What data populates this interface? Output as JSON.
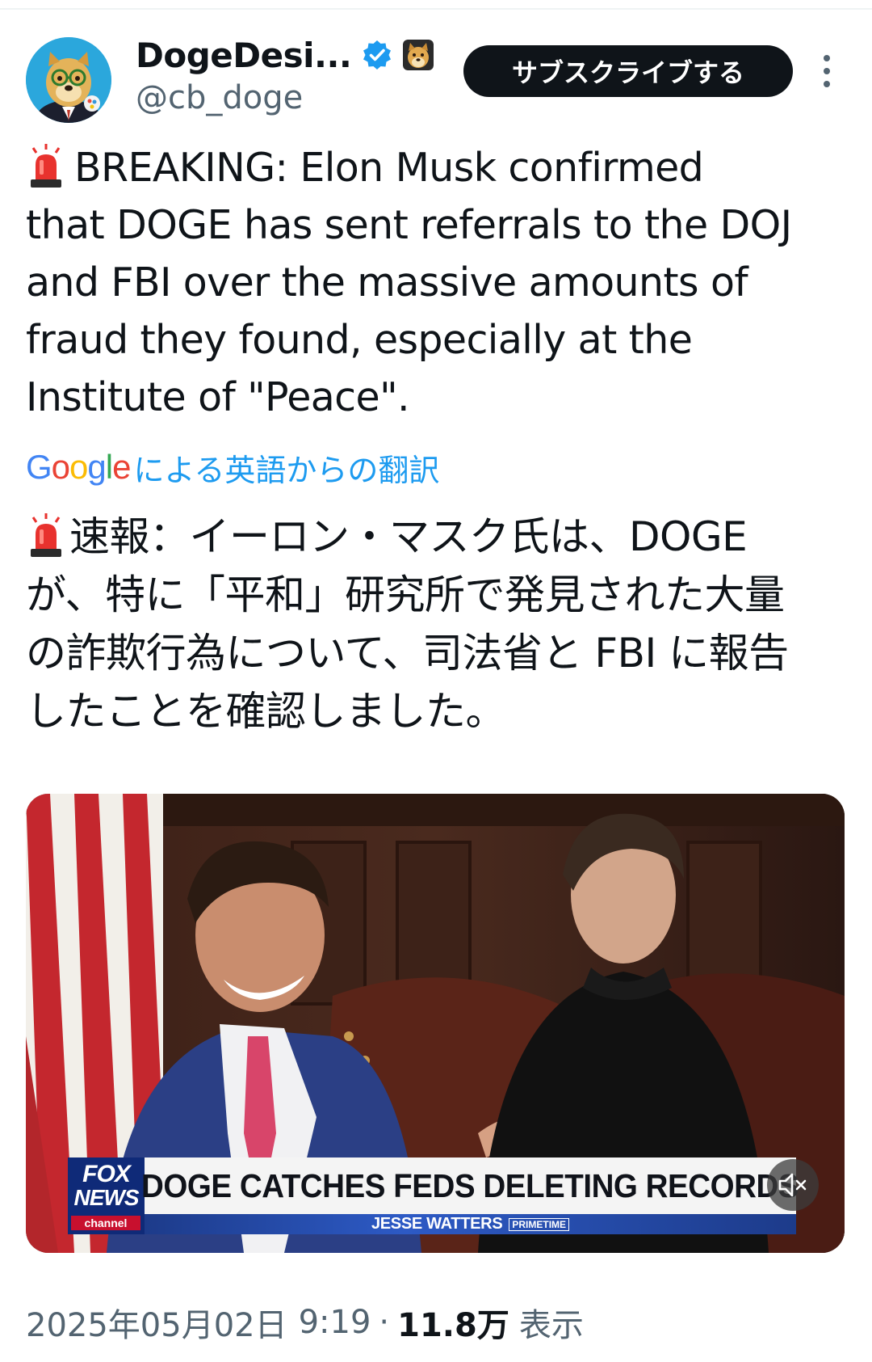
{
  "author": {
    "display_name": "DogeDesi...",
    "handle": "@cb_doge",
    "verified_badge": "verified-badge-icon",
    "affiliate_badge": "doge-affiliate-icon"
  },
  "header": {
    "subscribe_label": "サブスクライブする",
    "more_icon": "more-options-icon"
  },
  "tweet": {
    "emoji": "siren-emoji",
    "text": "BREAKING: Elon Musk confirmed\nthat DOGE has sent referrals to the DOJ\nand FBI over the massive amounts of\nfraud they found, especially at the\nInstitute of \"Peace\"."
  },
  "translation": {
    "provider": "Google",
    "label": "による英語からの翻訳",
    "text": "速報：イーロン・マスク氏は、DOGE\nが、特に「平和」研究所で発見された大量\nの詐欺行為について、司法省と FBI に報告\nしたことを確認しました。"
  },
  "media": {
    "network_line1": "FOX",
    "network_line2": "NEWS",
    "network_line3": "channel",
    "headline": "DOGE CATCHES FEDS DELETING RECORDS",
    "show_name": "JESSE WATTERS",
    "show_tag": "PRIMETIME",
    "mute_icon": "muted-speaker-icon"
  },
  "meta": {
    "date": "2025年05月02日",
    "time": "9:19",
    "separator": "·",
    "views_count": "11.8万",
    "views_label": "表示"
  },
  "colors": {
    "accent": "#1d9bf0",
    "text": "#0f1419",
    "secondary": "#536471",
    "button_bg": "#0f1419"
  }
}
